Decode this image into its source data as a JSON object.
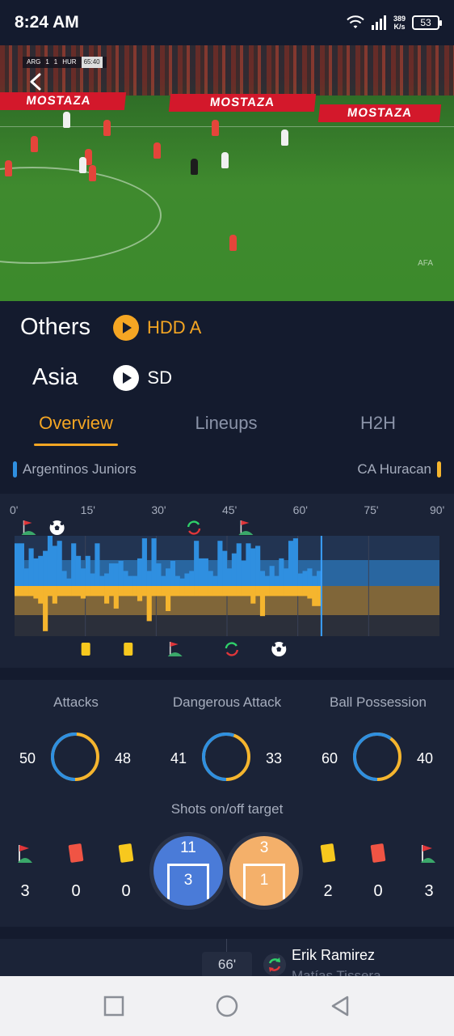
{
  "status_bar": {
    "time": "8:24 AM",
    "net_speed_value": "389",
    "net_speed_unit": "K/s",
    "battery": "53"
  },
  "video": {
    "scorebug": {
      "home": "ARG",
      "home_score": "1",
      "away_score": "1",
      "away": "HUR",
      "clock": "65:40"
    },
    "adboard_text": "MOSTAZA",
    "watermark": "AFA"
  },
  "sources": [
    {
      "region": "Others",
      "label": "HDD A",
      "color": "#f5a623"
    },
    {
      "region": "Asia",
      "label": "SD",
      "color": "#ffffff"
    }
  ],
  "tabs": [
    {
      "label": "Overview",
      "active": true
    },
    {
      "label": "Lineups",
      "active": false
    },
    {
      "label": "H2H",
      "active": false
    }
  ],
  "teams": {
    "home": {
      "name": "Argentinos Juniors",
      "color": "#2f8fe0"
    },
    "away": {
      "name": "CA Huracan",
      "color": "#f5b52e"
    }
  },
  "timeline": {
    "tick_labels": [
      "0'",
      "15'",
      "30'",
      "45'",
      "60'",
      "75'",
      "90'"
    ],
    "current_minute": 65,
    "home_events": [
      {
        "minute": 3,
        "type": "corner"
      },
      {
        "minute": 9,
        "type": "goal"
      },
      {
        "minute": 38,
        "type": "substitution"
      },
      {
        "minute": 49,
        "type": "corner"
      }
    ],
    "away_events": [
      {
        "minute": 15,
        "type": "yellow-card"
      },
      {
        "minute": 24,
        "type": "yellow-card"
      },
      {
        "minute": 34,
        "type": "corner"
      },
      {
        "minute": 46,
        "type": "substitution"
      },
      {
        "minute": 56,
        "type": "goal"
      }
    ],
    "home_pressure": [
      0.85,
      0.85,
      0.35,
      0.75,
      0.55,
      0.6,
      0.7,
      1.0,
      0.8,
      0.9,
      0.3,
      0.15,
      0.85,
      0.6,
      0.35,
      0.6,
      0.25,
      0.85,
      0.2,
      0.25,
      0.45,
      0.45,
      0.5,
      0.3,
      0.2,
      0.2,
      0.55,
      0.95,
      0.3,
      0.95,
      0.45,
      0.2,
      0.35,
      0.5,
      0.2,
      0.15,
      0.25,
      0.3,
      0.9,
      0.55,
      0.55,
      0.3,
      0.2,
      0.9,
      0.7,
      0.35,
      0.65,
      0.85,
      0.5,
      0.85,
      0.75,
      0.8,
      0.3,
      0.2,
      0.4,
      0.2,
      0.55,
      0.35,
      0.9,
      0.95,
      0.25,
      0.3,
      0.35,
      0.2,
      0.3
    ],
    "away_pressure": [
      0.2,
      0.2,
      0.2,
      0.2,
      0.25,
      0.35,
      0.9,
      0.2,
      0.35,
      0.2,
      0.2,
      0.2,
      0.2,
      0.2,
      0.25,
      0.2,
      0.2,
      0.2,
      0.2,
      0.35,
      0.2,
      0.45,
      0.2,
      0.2,
      0.2,
      0.2,
      0.3,
      0.2,
      0.7,
      0.2,
      0.2,
      0.2,
      0.5,
      0.2,
      0.2,
      0.2,
      0.2,
      0.2,
      0.2,
      0.2,
      0.2,
      0.2,
      0.2,
      0.2,
      0.2,
      0.2,
      0.2,
      0.2,
      0.2,
      0.2,
      0.35,
      0.2,
      0.6,
      0.2,
      0.2,
      0.2,
      0.2,
      0.2,
      0.2,
      0.2,
      0.2,
      0.2,
      0.25,
      0.4,
      0.4
    ]
  },
  "stats": [
    {
      "title": "Attacks",
      "home": "50",
      "away": "48",
      "home_value": 50,
      "away_value": 48
    },
    {
      "title": "Dangerous Attack",
      "home": "41",
      "away": "33",
      "home_value": 41,
      "away_value": 33
    },
    {
      "title": "Ball Possession",
      "home": "60",
      "away": "40",
      "home_value": 60,
      "away_value": 40
    }
  ],
  "shots": {
    "title": "Shots on/off target",
    "home": {
      "on": "11",
      "off": "3",
      "color": "#4a7bd8"
    },
    "away": {
      "on": "3",
      "off": "1",
      "color": "#f4b06a"
    }
  },
  "home_counts": {
    "corners": "3",
    "red_cards": "0",
    "yellow_cards": "0"
  },
  "away_counts": {
    "yellow_cards": "2",
    "red_cards": "0",
    "corners": "3"
  },
  "event_list": [
    {
      "minute": "66'",
      "player_in": "Erik Ramirez",
      "player_out": "Matías Tissera"
    }
  ]
}
